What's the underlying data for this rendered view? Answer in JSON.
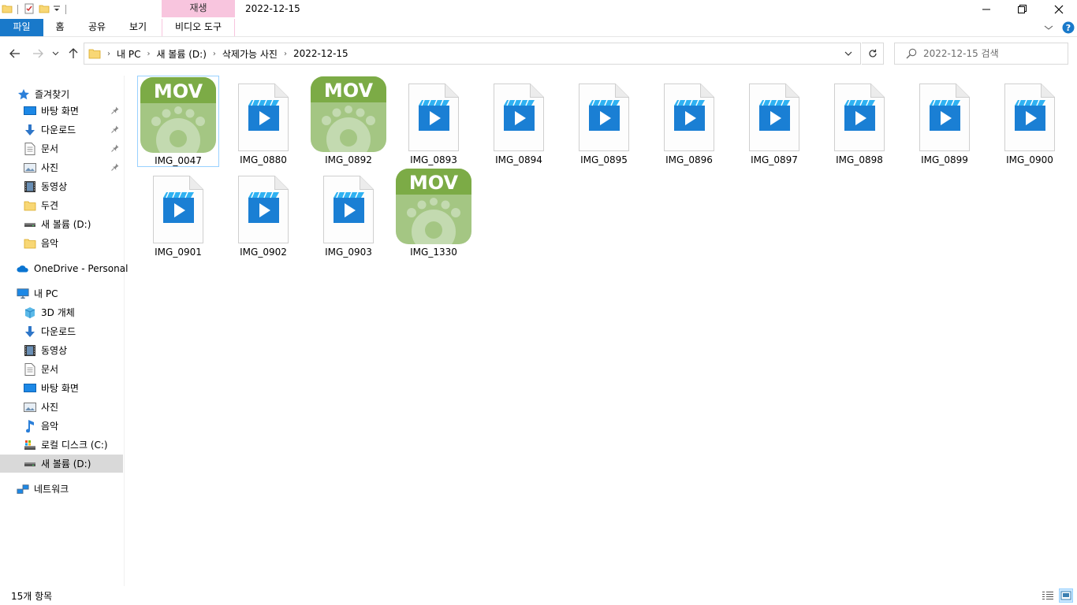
{
  "window": {
    "title": "2022-12-15",
    "context_tab": "재생"
  },
  "ribbon": {
    "tabs": [
      "파일",
      "홈",
      "공유",
      "보기",
      "비디오 도구"
    ],
    "accent": "#1979ca",
    "context_color": "#f8c5de"
  },
  "address": {
    "crumbs": [
      "내 PC",
      "새 볼륨 (D:)",
      "삭제가능 사진",
      "2022-12-15"
    ]
  },
  "search": {
    "placeholder": "2022-12-15 검색"
  },
  "sidebar": {
    "items": [
      {
        "label": "즐겨찾기",
        "icon": "star-icon"
      },
      {
        "label": "바탕 화면",
        "icon": "desktop-icon",
        "pinned": true
      },
      {
        "label": "다운로드",
        "icon": "download-icon",
        "pinned": true
      },
      {
        "label": "문서",
        "icon": "document-icon",
        "pinned": true
      },
      {
        "label": "사진",
        "icon": "pictures-icon",
        "pinned": true
      },
      {
        "label": "동영상",
        "icon": "videos-icon"
      },
      {
        "label": "두견",
        "icon": "folder-icon"
      },
      {
        "label": "새 볼륨 (D:)",
        "icon": "drive-icon"
      },
      {
        "label": "음악",
        "icon": "folder-icon"
      },
      {
        "label": "OneDrive - Personal",
        "icon": "onedrive-icon"
      },
      {
        "label": "내 PC",
        "icon": "computer-icon"
      },
      {
        "label": "3D 개체",
        "icon": "3d-objects-icon"
      },
      {
        "label": "다운로드",
        "icon": "download-icon"
      },
      {
        "label": "동영상",
        "icon": "videos-icon"
      },
      {
        "label": "문서",
        "icon": "document-icon"
      },
      {
        "label": "바탕 화면",
        "icon": "desktop-icon"
      },
      {
        "label": "사진",
        "icon": "pictures-icon"
      },
      {
        "label": "음악",
        "icon": "music-icon"
      },
      {
        "label": "로컬 디스크 (C:)",
        "icon": "local-disk-icon"
      },
      {
        "label": "새 볼륨 (D:)",
        "icon": "drive-icon",
        "selected": true
      },
      {
        "label": "네트워크",
        "icon": "network-icon"
      }
    ]
  },
  "files": [
    {
      "name": "IMG_0047",
      "type": "mov",
      "selected": true
    },
    {
      "name": "IMG_0880",
      "type": "video"
    },
    {
      "name": "IMG_0892",
      "type": "mov"
    },
    {
      "name": "IMG_0893",
      "type": "video"
    },
    {
      "name": "IMG_0894",
      "type": "video"
    },
    {
      "name": "IMG_0895",
      "type": "video"
    },
    {
      "name": "IMG_0896",
      "type": "video"
    },
    {
      "name": "IMG_0897",
      "type": "video"
    },
    {
      "name": "IMG_0898",
      "type": "video"
    },
    {
      "name": "IMG_0899",
      "type": "video"
    },
    {
      "name": "IMG_0900",
      "type": "video"
    },
    {
      "name": "IMG_0901",
      "type": "video"
    },
    {
      "name": "IMG_0902",
      "type": "video"
    },
    {
      "name": "IMG_0903",
      "type": "video"
    },
    {
      "name": "IMG_1330",
      "type": "mov"
    }
  ],
  "mov_badge": "MOV",
  "colors": {
    "mov_green": "#7cab46",
    "mov_light": "#a4c683",
    "video_blue": "#1a7fd4"
  },
  "status": {
    "count": "15개 항목"
  }
}
